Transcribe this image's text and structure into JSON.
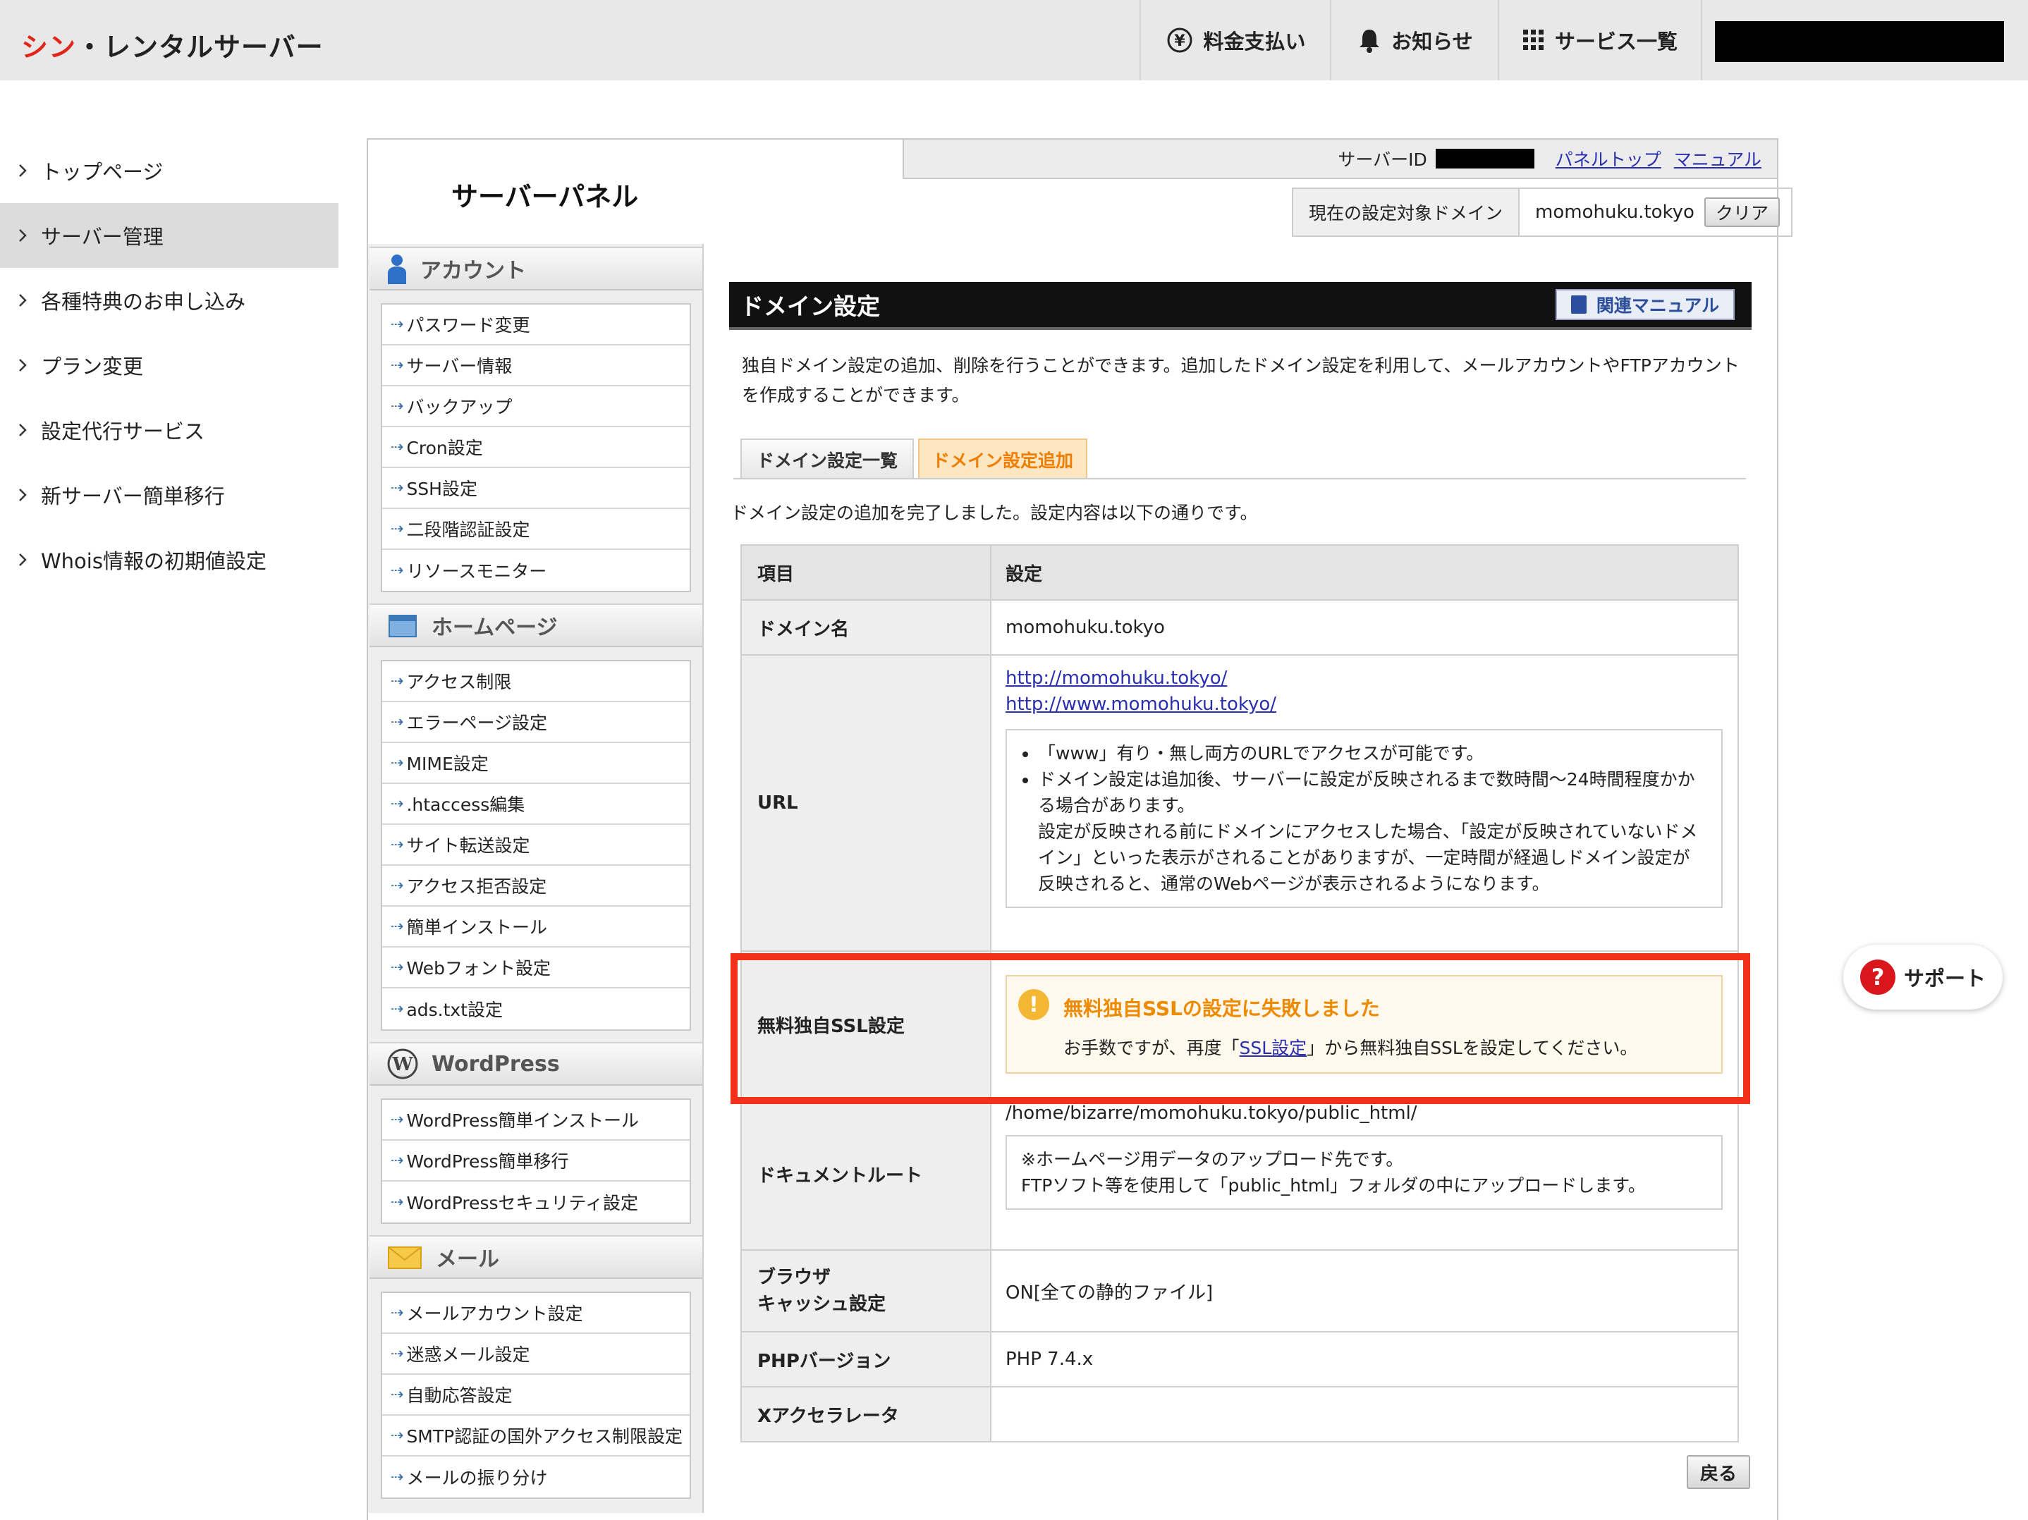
{
  "brand": {
    "part1": "シン",
    "part2": "・レンタルサーバー"
  },
  "topnav": {
    "pay": "料金支払い",
    "news": "お知らせ",
    "services": "サービス一覧"
  },
  "leftnav": [
    {
      "label": "トップページ"
    },
    {
      "label": "サーバー管理",
      "active": true
    },
    {
      "label": "各種特典のお申し込み"
    },
    {
      "label": "プラン変更"
    },
    {
      "label": "設定代行サービス"
    },
    {
      "label": "新サーバー簡単移行"
    },
    {
      "label": "Whois情報の初期値設定"
    }
  ],
  "panel": {
    "title": "サーバーパネル",
    "server_id_label": "サーバーID",
    "panel_top": "パネルトップ",
    "manual": "マニュアル",
    "current_domain_label": "現在の設定対象ドメイン",
    "current_domain": "momohuku.tokyo",
    "clear": "クリア"
  },
  "sidebar": {
    "account": {
      "title": "アカウント",
      "items": [
        "パスワード変更",
        "サーバー情報",
        "バックアップ",
        "Cron設定",
        "SSH設定",
        "二段階認証設定",
        "リソースモニター"
      ]
    },
    "homepage": {
      "title": "ホームページ",
      "items": [
        "アクセス制限",
        "エラーページ設定",
        "MIME設定",
        ".htaccess編集",
        "サイト転送設定",
        "アクセス拒否設定",
        "簡単インストール",
        "Webフォント設定",
        "ads.txt設定"
      ]
    },
    "wordpress": {
      "title": "WordPress",
      "items": [
        "WordPress簡単インストール",
        "WordPress簡単移行",
        "WordPressセキュリティ設定"
      ]
    },
    "mail": {
      "title": "メール",
      "items": [
        "メールアカウント設定",
        "迷惑メール設定",
        "自動応答設定",
        "SMTP認証の国外アクセス制限設定",
        "メールの振り分け"
      ]
    }
  },
  "main": {
    "title": "ドメイン設定",
    "related_manual": "関連マニュアル",
    "description": "独自ドメイン設定の追加、削除を行うことができます。追加したドメイン設定を利用して、メールアカウントやFTPアカウントを作成することができます。",
    "tabs": {
      "list": "ドメイン設定一覧",
      "add": "ドメイン設定追加"
    },
    "complete_message": "ドメイン設定の追加を完了しました。設定内容は以下の通りです。",
    "table": {
      "col_item": "項目",
      "col_setting": "設定",
      "domain_label": "ドメイン名",
      "domain_value": "momohuku.tokyo",
      "url_label": "URL",
      "url1": "http://momohuku.tokyo/",
      "url2": "http://www.momohuku.tokyo/",
      "url_note1": "「www」有り・無し両方のURLでアクセスが可能です。",
      "url_note2": "ドメイン設定は追加後、サーバーに設定が反映されるまで数時間〜24時間程度かかる場合があります。",
      "url_note3": "設定が反映される前にドメインにアクセスした場合、「設定が反映されていないドメイン」といった表示がされることがありますが、一定時間が経過しドメイン設定が反映されると、通常のWebページが表示されるようになります。",
      "ssl_label": "無料独自SSL設定",
      "ssl_error_title": "無料独自SSLの設定に失敗しました",
      "ssl_error_pre": "お手数ですが、再度「",
      "ssl_error_link": "SSL設定",
      "ssl_error_post": "」から無料独自SSLを設定してください。",
      "docroot_label": "ドキュメントルート",
      "docroot_value": "/home/bizarre/momohuku.tokyo/public_html/",
      "docroot_note1": "※ホームページ用データのアップロード先です。",
      "docroot_note2": "FTPソフト等を使用して「public_html」フォルダの中にアップロードします。",
      "cache_label1": "ブラウザ",
      "cache_label2": "キャッシュ設定",
      "cache_value": "ON[全ての静的ファイル]",
      "php_label": "PHPバージョン",
      "php_value": "PHP 7.4.x",
      "xacc_label": "Xアクセラレータ",
      "xacc_value": ""
    },
    "back": "戻る"
  },
  "support": "サポート",
  "colors": {
    "brand_red": "#e0261b",
    "highlight_red": "#f3301a",
    "tab_orange": "#ee7d00",
    "warning": "#ee8a00"
  }
}
